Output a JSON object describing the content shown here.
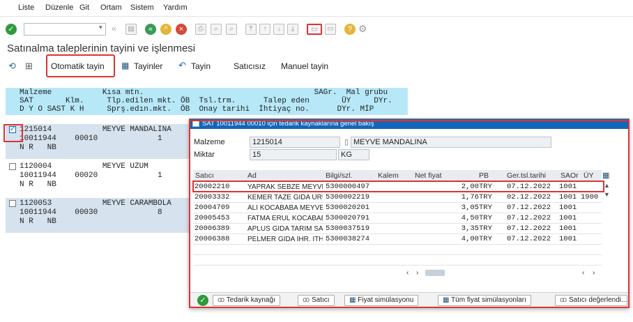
{
  "menu": [
    "Liste",
    "Düzenle",
    "Git",
    "Ortam",
    "Sistem",
    "Yardım"
  ],
  "page_title": "Satınalma taleplerinin tayini ve işlenmesi",
  "app_toolbar": {
    "auto_assign": "Otomatik tayin",
    "assignments": "Tayinler",
    "assign": "Tayin",
    "no_vendor": "Satıcısız",
    "manual_assign": "Manuel tayin"
  },
  "list_header": {
    "line1": "Malzeme           Kısa mtn.                                     SAGr.  Mal grubu",
    "line2": "SAT       Klm.     Tlp.edilen mkt. ÖB  Tsl.trm.      Talep eden       ÜY     DYr.",
    "line3": "D Y O SAST K H     Sprş.edın.mkt.  ÖB  Onay tarihi  İhtiyaç no.      DYr. MİP"
  },
  "list_rows": [
    {
      "checked": true,
      "line1": "1215014           MEYVE MANDALINA",
      "line2": "10011944    00010             1",
      "line3": "N R   NB"
    },
    {
      "checked": false,
      "line1": "1120004           MEYVE UZUM",
      "line2": "10011944    00020             1",
      "line3": "N R   NB"
    },
    {
      "checked": false,
      "line1": "1120053           MEYVE CARAMBOLA",
      "line2": "10011944    00030             8",
      "line3": "N R   NB"
    }
  ],
  "popup": {
    "title": "SAT 10011944 00010 için tedarik kaynaklarına genel bakış",
    "material_label": "Malzeme",
    "material_value": "1215014",
    "material_desc": "MEYVE MANDALINA",
    "quantity_label": "Miktar",
    "quantity_value": "15",
    "unit": "KG",
    "columns": [
      "Satıcı",
      "Ad",
      "Bilgi/szl.",
      "Kalem",
      "Net fiyat",
      "PB",
      "Ger.tsl.tarihi",
      "SAOr",
      "ÜY"
    ],
    "rows": [
      {
        "vendor": "20002210",
        "name": "YAPRAK SEBZE MEYVE ...",
        "info": "5300000497",
        "item": "",
        "price": "2,00",
        "currency": "TRY",
        "date": "07.12.2022",
        "org": "1001",
        "uy": ""
      },
      {
        "vendor": "20003332",
        "name": "KEMER TAZE GIDA ÜRÜ...",
        "info": "5300002219",
        "item": "",
        "price": "1,76",
        "currency": "TRY",
        "date": "02.12.2022",
        "org": "1001",
        "uy": "1900"
      },
      {
        "vendor": "20004709",
        "name": "ALİ KOCABABA MEYVE ...",
        "info": "5300020201",
        "item": "",
        "price": "3,05",
        "currency": "TRY",
        "date": "07.12.2022",
        "org": "1001",
        "uy": ""
      },
      {
        "vendor": "20005453",
        "name": "FATMA ERUL KOCABAB...",
        "info": "5300020791",
        "item": "",
        "price": "4,50",
        "currency": "TRY",
        "date": "07.12.2022",
        "org": "1001",
        "uy": ""
      },
      {
        "vendor": "20006389",
        "name": "APLUS GIDA TARIM SA...",
        "info": "5300037519",
        "item": "",
        "price": "3,35",
        "currency": "TRY",
        "date": "07.12.2022",
        "org": "1001",
        "uy": ""
      },
      {
        "vendor": "20006388",
        "name": "PELMER GIDA İHR. İTH...",
        "info": "5300038274",
        "item": "",
        "price": "4,00",
        "currency": "TRY",
        "date": "07.12.2022",
        "org": "1001",
        "uy": ""
      }
    ],
    "footer_buttons": [
      "Tedarik kaynağı",
      "Satıcı",
      "Fiyat simülasyonu",
      "Tüm fiyat simülasyonları",
      "Satıcı değerlendi..."
    ]
  },
  "colors": {
    "title_bar": "#1466b8",
    "header_bg": "#b7e8f8",
    "highlight": "#dd3333",
    "ok_green": "#2e9a3c"
  }
}
